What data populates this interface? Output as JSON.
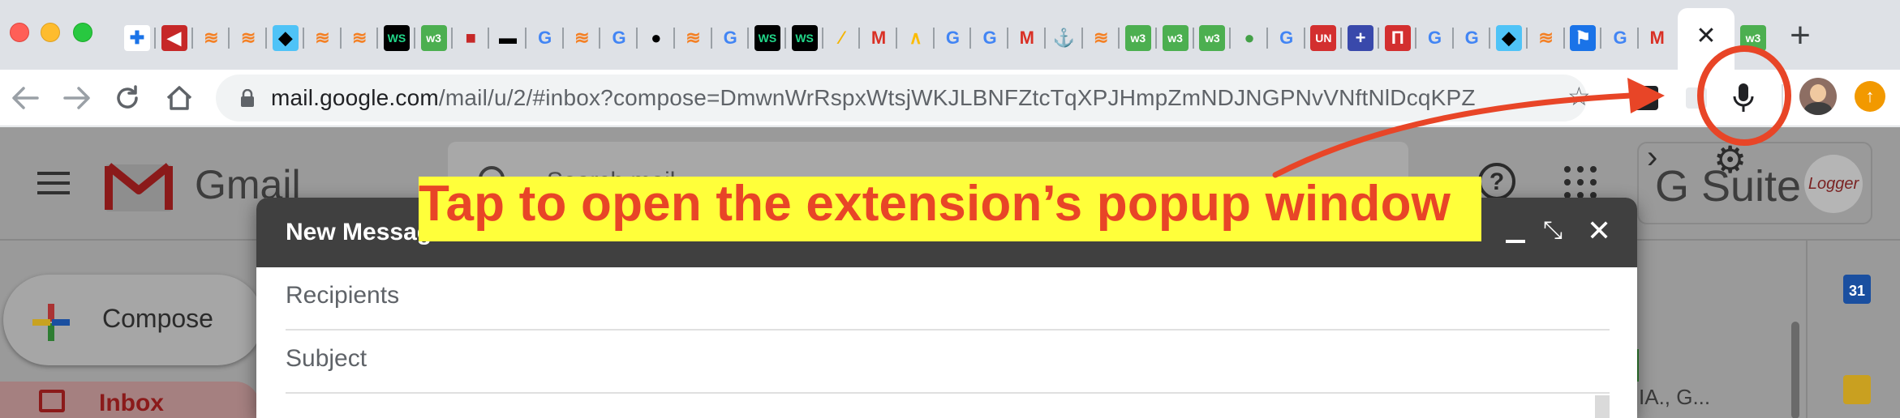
{
  "browser": {
    "favicons": [
      {
        "name": "puzzle-icon",
        "glyph": "✚",
        "bg": "#ffffff",
        "fg": "#1a73e8"
      },
      {
        "name": "speaker-icon",
        "glyph": "◀",
        "bg": "#c62828",
        "fg": "#ffffff"
      },
      {
        "name": "stackoverflow-icon",
        "glyph": "≋",
        "bg": "transparent",
        "fg": "#f48024"
      },
      {
        "name": "stackoverflow-icon",
        "glyph": "≋",
        "bg": "transparent",
        "fg": "#f48024"
      },
      {
        "name": "bird-icon",
        "glyph": "◆",
        "bg": "#4fc3f7",
        "fg": "#000000"
      },
      {
        "name": "stackoverflow-icon",
        "glyph": "≋",
        "bg": "transparent",
        "fg": "#f48024"
      },
      {
        "name": "stackoverflow-icon",
        "glyph": "≋",
        "bg": "transparent",
        "fg": "#f48024"
      },
      {
        "name": "webstorm-icon",
        "glyph": "WS",
        "bg": "#000000",
        "fg": "#21d789"
      },
      {
        "name": "w3schools-icon",
        "glyph": "w3",
        "bg": "#4caf50",
        "fg": "#ffffff"
      },
      {
        "name": "shopping-bag-icon",
        "glyph": "■",
        "bg": "transparent",
        "fg": "#c62828"
      },
      {
        "name": "dark-pill-icon",
        "glyph": "▬",
        "bg": "transparent",
        "fg": "#000000"
      },
      {
        "name": "google-icon",
        "glyph": "G",
        "bg": "transparent",
        "fg": "#4285f4"
      },
      {
        "name": "stackoverflow-icon",
        "glyph": "≋",
        "bg": "transparent",
        "fg": "#f48024"
      },
      {
        "name": "google-icon",
        "glyph": "G",
        "bg": "transparent",
        "fg": "#4285f4"
      },
      {
        "name": "microphone-icon",
        "glyph": "●",
        "bg": "transparent",
        "fg": "#000000"
      },
      {
        "name": "stackoverflow-icon",
        "glyph": "≋",
        "bg": "transparent",
        "fg": "#f48024"
      },
      {
        "name": "google-icon",
        "glyph": "G",
        "bg": "transparent",
        "fg": "#4285f4"
      },
      {
        "name": "webstorm-icon",
        "glyph": "WS",
        "bg": "#000000",
        "fg": "#21d789"
      },
      {
        "name": "webstorm-icon",
        "glyph": "WS",
        "bg": "#000000",
        "fg": "#21d789"
      },
      {
        "name": "stripes-icon",
        "glyph": "⁄",
        "bg": "transparent",
        "fg": "#f4b400"
      },
      {
        "name": "gmail-icon",
        "glyph": "M",
        "bg": "transparent",
        "fg": "#d93025"
      },
      {
        "name": "google-ads-icon",
        "glyph": "∧",
        "bg": "transparent",
        "fg": "#fbbc04"
      },
      {
        "name": "google-icon",
        "glyph": "G",
        "bg": "transparent",
        "fg": "#4285f4"
      },
      {
        "name": "google-icon",
        "glyph": "G",
        "bg": "transparent",
        "fg": "#4285f4"
      },
      {
        "name": "gmail-icon",
        "glyph": "M",
        "bg": "transparent",
        "fg": "#d93025"
      },
      {
        "name": "anchor-icon",
        "glyph": "⚓",
        "bg": "transparent",
        "fg": "#37474f"
      },
      {
        "name": "stackoverflow-icon",
        "glyph": "≋",
        "bg": "transparent",
        "fg": "#f48024"
      },
      {
        "name": "w3schools-icon",
        "glyph": "w3",
        "bg": "#4caf50",
        "fg": "#ffffff"
      },
      {
        "name": "w3schools-icon",
        "glyph": "w3",
        "bg": "#4caf50",
        "fg": "#ffffff"
      },
      {
        "name": "w3schools-icon",
        "glyph": "w3",
        "bg": "#4caf50",
        "fg": "#ffffff"
      },
      {
        "name": "leaf-icon",
        "glyph": "●",
        "bg": "transparent",
        "fg": "#43a047"
      },
      {
        "name": "google-icon",
        "glyph": "G",
        "bg": "transparent",
        "fg": "#4285f4"
      },
      {
        "name": "un-icon",
        "glyph": "UN",
        "bg": "#d32f2f",
        "fg": "#ffffff"
      },
      {
        "name": "purple-square-icon",
        "glyph": "+",
        "bg": "#3949ab",
        "fg": "#ffffff"
      },
      {
        "name": "red-box-icon",
        "glyph": "Π",
        "bg": "#d32f2f",
        "fg": "#ffffff"
      },
      {
        "name": "google-icon",
        "glyph": "G",
        "bg": "transparent",
        "fg": "#4285f4"
      },
      {
        "name": "google-icon",
        "glyph": "G",
        "bg": "transparent",
        "fg": "#4285f4"
      },
      {
        "name": "bird-icon",
        "glyph": "◆",
        "bg": "#4fc3f7",
        "fg": "#000000"
      },
      {
        "name": "stackoverflow-icon",
        "glyph": "≋",
        "bg": "transparent",
        "fg": "#f48024"
      },
      {
        "name": "flag-icon",
        "glyph": "⚑",
        "bg": "#1a73e8",
        "fg": "#ffffff"
      },
      {
        "name": "google-icon",
        "glyph": "G",
        "bg": "transparent",
        "fg": "#4285f4"
      },
      {
        "name": "gmail-icon",
        "glyph": "M",
        "bg": "transparent",
        "fg": "#d93025"
      }
    ],
    "active_tab_favicon": {
      "name": "w3schools-icon",
      "glyph": "w3",
      "bg": "#4caf50",
      "fg": "#ffffff"
    },
    "active_tab_close": "✕",
    "new_tab": "+",
    "url_host": "mail.google.com",
    "url_path": "/mail/u/2/#inbox?compose=DmwnWrRspxWtsjWKJLBNFZtcTqXPJHmpZmNDJNGPNvVNftNlDcqKPZ",
    "bookmark_star": "☆"
  },
  "gmail": {
    "logo_text": "Gmail",
    "search_placeholder": "Search mail",
    "help": "?",
    "gsuite_text": "G Suite",
    "gsuite_badge": "Logger",
    "compose_label": "Compose",
    "inbox_label": "Inbox",
    "calendar_day": "31",
    "email_sender": "IA., G..."
  },
  "compose": {
    "title": "New Message",
    "recipients_placeholder": "Recipients",
    "subject_placeholder": "Subject"
  },
  "annotation": {
    "text": "Tap to open the extension’s popup window",
    "color": "#e84527",
    "highlight": "#ffff3a"
  }
}
